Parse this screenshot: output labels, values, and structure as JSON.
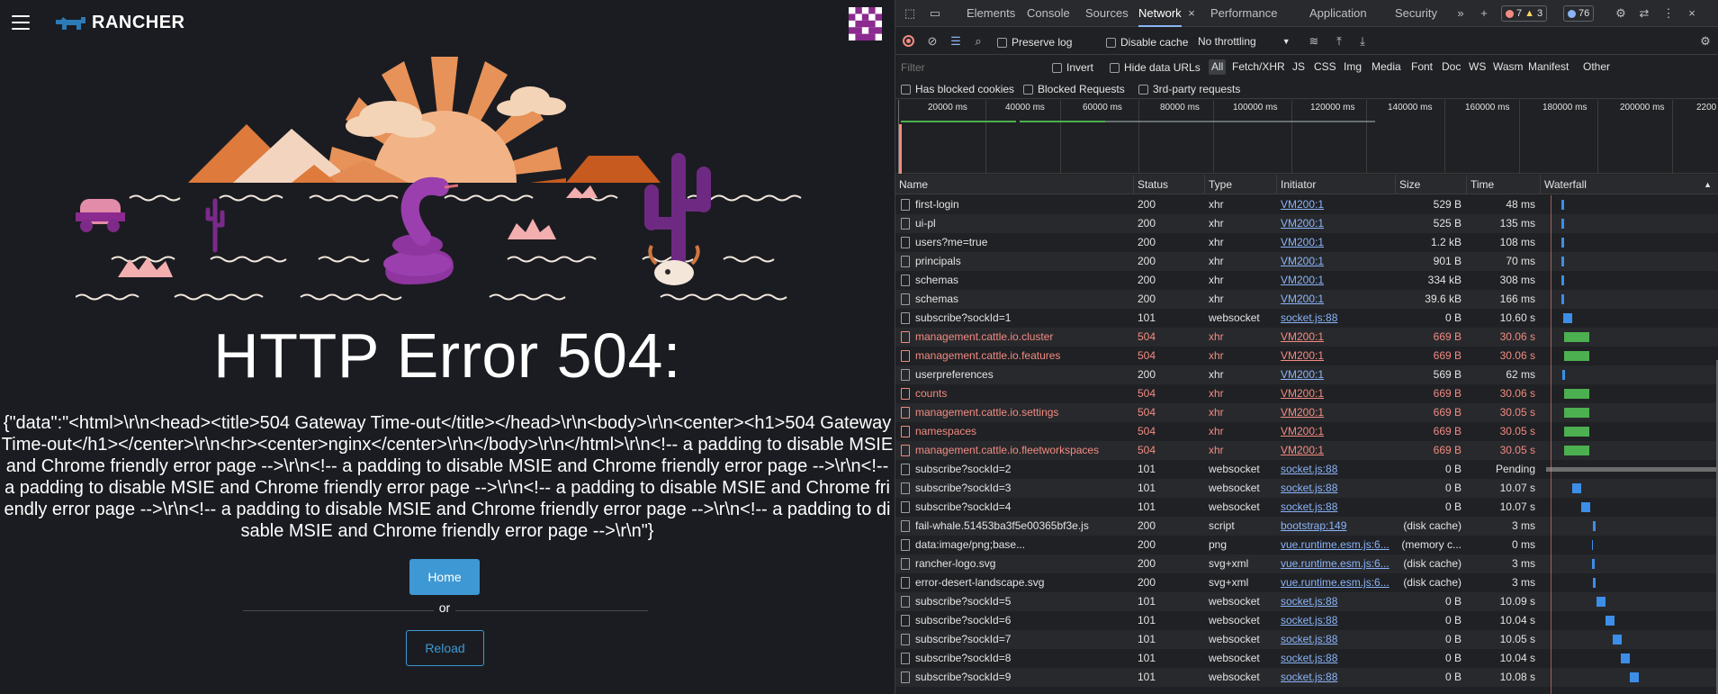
{
  "rancher": {
    "logo_text": "RANCHER",
    "error_title": "HTTP Error 504:",
    "error_body": "{\"data\":\"<html>\\r\\n<head><title>504 Gateway Time-out</title></head>\\r\\n<body>\\r\\n<center><h1>504 Gateway Time-out</h1></center>\\r\\n<hr><center>nginx</center>\\r\\n</body>\\r\\n</html>\\r\\n<!-- a padding to disable MSIE and Chrome friendly error page -->\\r\\n<!-- a padding to disable MSIE and Chrome friendly error page -->\\r\\n<!-- a padding to disable MSIE and Chrome friendly error page -->\\r\\n<!-- a padding to disable MSIE and Chrome friendly error page -->\\r\\n<!-- a padding to disable MSIE and Chrome friendly error page -->\\r\\n<!-- a padding to disable MSIE and Chrome friendly error page -->\\r\\n\"}",
    "home_label": "Home",
    "or_label": "or",
    "reload_label": "Reload"
  },
  "devtools": {
    "tabs": [
      "Elements",
      "Console",
      "Sources",
      "Network",
      "Performance",
      "Application",
      "Security"
    ],
    "active_tab": "Network",
    "more_tabs": "»",
    "counts": {
      "errors": "7",
      "warnings": "3",
      "issues": "76"
    },
    "toolbar": {
      "preserve_log": "Preserve log",
      "disable_cache": "Disable cache",
      "throttling": "No throttling"
    },
    "filter": {
      "placeholder": "Filter",
      "invert": "Invert",
      "hide_data_urls": "Hide data URLs",
      "types": [
        "All",
        "Fetch/XHR",
        "JS",
        "CSS",
        "Img",
        "Media",
        "Font",
        "Doc",
        "WS",
        "Wasm",
        "Manifest",
        "Other"
      ],
      "has_blocked_cookies": "Has blocked cookies",
      "blocked_requests": "Blocked Requests",
      "third_party": "3rd-party requests"
    },
    "overview_ticks": [
      "20000 ms",
      "40000 ms",
      "60000 ms",
      "80000 ms",
      "100000 ms",
      "120000 ms",
      "140000 ms",
      "160000 ms",
      "180000 ms",
      "200000 ms",
      "2200"
    ],
    "columns": [
      "Name",
      "Status",
      "Type",
      "Initiator",
      "Size",
      "Time",
      "Waterfall"
    ],
    "requests": [
      {
        "name": "first-login",
        "status": "200",
        "type": "xhr",
        "initiator": "VM200:1",
        "size": "529 B",
        "time": "48 ms"
      },
      {
        "name": "ui-pl",
        "status": "200",
        "type": "xhr",
        "initiator": "VM200:1",
        "size": "525 B",
        "time": "135 ms"
      },
      {
        "name": "users?me=true",
        "status": "200",
        "type": "xhr",
        "initiator": "VM200:1",
        "size": "1.2 kB",
        "time": "108 ms"
      },
      {
        "name": "principals",
        "status": "200",
        "type": "xhr",
        "initiator": "VM200:1",
        "size": "901 B",
        "time": "70 ms"
      },
      {
        "name": "schemas",
        "status": "200",
        "type": "xhr",
        "initiator": "VM200:1",
        "size": "334 kB",
        "time": "308 ms"
      },
      {
        "name": "schemas",
        "status": "200",
        "type": "xhr",
        "initiator": "VM200:1",
        "size": "39.6 kB",
        "time": "166 ms"
      },
      {
        "name": "subscribe?sockId=1",
        "status": "101",
        "type": "websocket",
        "initiator": "socket.js:88",
        "size": "0 B",
        "time": "10.60 s"
      },
      {
        "name": "management.cattle.io.cluster",
        "status": "504",
        "type": "xhr",
        "initiator": "VM200:1",
        "size": "669 B",
        "time": "30.06 s",
        "error": true
      },
      {
        "name": "management.cattle.io.features",
        "status": "504",
        "type": "xhr",
        "initiator": "VM200:1",
        "size": "669 B",
        "time": "30.06 s",
        "error": true
      },
      {
        "name": "userpreferences",
        "status": "200",
        "type": "xhr",
        "initiator": "VM200:1",
        "size": "569 B",
        "time": "62 ms"
      },
      {
        "name": "counts",
        "status": "504",
        "type": "xhr",
        "initiator": "VM200:1",
        "size": "669 B",
        "time": "30.06 s",
        "error": true
      },
      {
        "name": "management.cattle.io.settings",
        "status": "504",
        "type": "xhr",
        "initiator": "VM200:1",
        "size": "669 B",
        "time": "30.05 s",
        "error": true
      },
      {
        "name": "namespaces",
        "status": "504",
        "type": "xhr",
        "initiator": "VM200:1",
        "size": "669 B",
        "time": "30.05 s",
        "error": true
      },
      {
        "name": "management.cattle.io.fleetworkspaces",
        "status": "504",
        "type": "xhr",
        "initiator": "VM200:1",
        "size": "669 B",
        "time": "30.05 s",
        "error": true
      },
      {
        "name": "subscribe?sockId=2",
        "status": "101",
        "type": "websocket",
        "initiator": "socket.js:88",
        "size": "0 B",
        "time": "Pending"
      },
      {
        "name": "subscribe?sockId=3",
        "status": "101",
        "type": "websocket",
        "initiator": "socket.js:88",
        "size": "0 B",
        "time": "10.07 s"
      },
      {
        "name": "subscribe?sockId=4",
        "status": "101",
        "type": "websocket",
        "initiator": "socket.js:88",
        "size": "0 B",
        "time": "10.07 s"
      },
      {
        "name": "fail-whale.51453ba3f5e00365bf3e.js",
        "status": "200",
        "type": "script",
        "initiator": "bootstrap:149",
        "size": "(disk cache)",
        "time": "3 ms"
      },
      {
        "name": "data:image/png;base...",
        "status": "200",
        "type": "png",
        "initiator": "vue.runtime.esm.js:6...",
        "size": "(memory c...",
        "time": "0 ms"
      },
      {
        "name": "rancher-logo.svg",
        "status": "200",
        "type": "svg+xml",
        "initiator": "vue.runtime.esm.js:6...",
        "size": "(disk cache)",
        "time": "3 ms"
      },
      {
        "name": "error-desert-landscape.svg",
        "status": "200",
        "type": "svg+xml",
        "initiator": "vue.runtime.esm.js:6...",
        "size": "(disk cache)",
        "time": "3 ms"
      },
      {
        "name": "subscribe?sockId=5",
        "status": "101",
        "type": "websocket",
        "initiator": "socket.js:88",
        "size": "0 B",
        "time": "10.09 s"
      },
      {
        "name": "subscribe?sockId=6",
        "status": "101",
        "type": "websocket",
        "initiator": "socket.js:88",
        "size": "0 B",
        "time": "10.04 s"
      },
      {
        "name": "subscribe?sockId=7",
        "status": "101",
        "type": "websocket",
        "initiator": "socket.js:88",
        "size": "0 B",
        "time": "10.05 s"
      },
      {
        "name": "subscribe?sockId=8",
        "status": "101",
        "type": "websocket",
        "initiator": "socket.js:88",
        "size": "0 B",
        "time": "10.04 s"
      },
      {
        "name": "subscribe?sockId=9",
        "status": "101",
        "type": "websocket",
        "initiator": "socket.js:88",
        "size": "0 B",
        "time": "10.08 s"
      }
    ],
    "colors": {
      "error_text": "#f28b82",
      "link": "#8ab4f8",
      "wf_green": "#4caf50",
      "wf_blue": "#3d8ee8"
    }
  }
}
